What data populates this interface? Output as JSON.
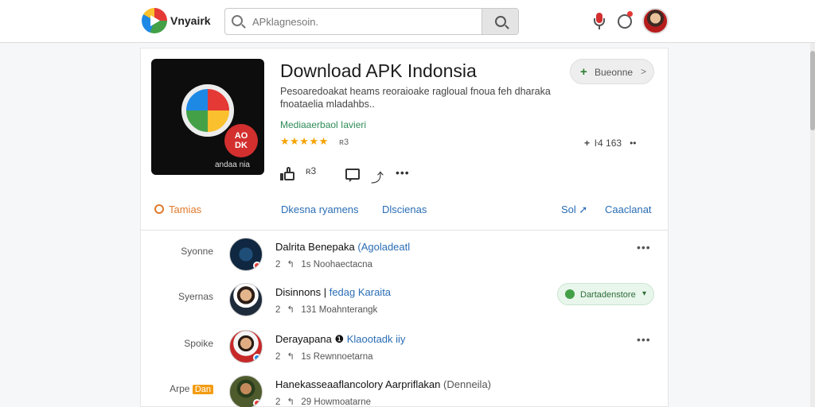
{
  "header": {
    "brand": "Vnyairk",
    "search_placeholder": "APklagnesoin."
  },
  "app": {
    "title": "Download APK Indonsia",
    "description": "Pesoaredoakat heams reoraioake ragloual fnoua feh dharaka fnoataelia mladahbs..",
    "developer": "Mediaaerbaol Iavieri",
    "stars": "★★★★★",
    "rating": "ʀ3",
    "icon_badge_top": "AO",
    "icon_badge_bottom": "DK",
    "icon_caption": "andaa nia",
    "like_count": "ʀ3",
    "follow_label": "Bueonne",
    "follow_chevron": ">",
    "stats_text": "ŀ4 163"
  },
  "tabs": {
    "topics": "Tamias",
    "tab_a": "Dkesna ryamens",
    "tab_b": "Dlscienas",
    "sort": "Sol",
    "cancel": "Caaclanat"
  },
  "rows": [
    {
      "category": "Syonne",
      "category_tag": "",
      "name": "Dalrita Benepaka",
      "link": "(Agoladeatl",
      "count": "2",
      "meta": "1s Noohaectacna",
      "mark_color": "#e53935",
      "pill_label": ""
    },
    {
      "category": "Syernas",
      "category_tag": "",
      "name": "Disinnons |",
      "link": "fedag Karaita",
      "count": "2",
      "meta": "131 Moahnterangk",
      "mark_color": "",
      "pill_label": "Dartadenstore"
    },
    {
      "category": "Spoike",
      "category_tag": "",
      "name": "Derayapana ❶",
      "link": "Klaootadk iiy",
      "count": "2",
      "meta": "1s Rewnnoetarna",
      "mark_color": "#1e88e5",
      "pill_label": ""
    },
    {
      "category": "Arpe",
      "category_tag": "Dan",
      "name": "Hanekasseaaflancolory Aarpriflakan",
      "link": "(Denneila)",
      "count": "2",
      "meta": "29 Howmoatarne",
      "mark_color": "#e53935",
      "pill_label": ""
    }
  ],
  "icons": [
    "brand-logo-icon",
    "search-icon",
    "mic-icon",
    "notification-icon",
    "thumbs-up-icon",
    "comment-icon",
    "share-icon",
    "more-icon",
    "plus-icon",
    "clock-icon",
    "sort-icon",
    "reply-icon"
  ],
  "colors": {
    "accent_blue": "#2a6db5",
    "accent_orange": "#e07a2c",
    "green": "#2e8b57",
    "star": "#f4a300"
  }
}
